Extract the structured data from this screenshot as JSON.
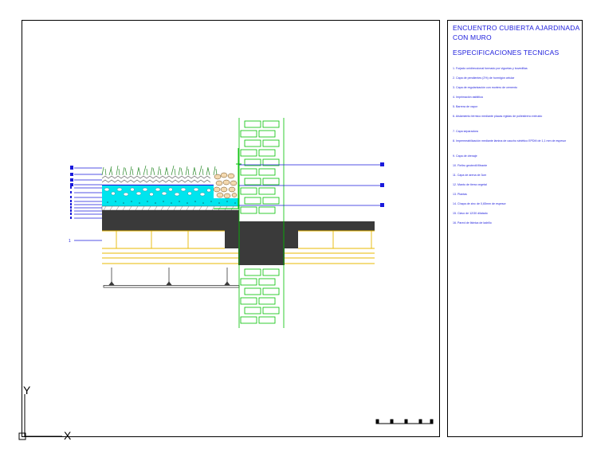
{
  "title_block": {
    "title_line1": "ENCUENTRO CUBIERTA AJARDINADA",
    "title_line2": "CON  MURO",
    "subtitle": "ESPECIFICACIONES TECNICAS",
    "specs": [
      "1. Forjado unidireccional formado por viguetas y bovedillas",
      "2. Capa de pendientes (2%) de hormigón celular",
      "3. Capa de regularización con mortero de cemento",
      "4. Imprimación asfáltica",
      "5. Barrera de vapor",
      "6. Aislamiento térmico mediante placas rígidas de poliestireno extruido",
      "7. Capa separadora",
      "8. Impermeabilización mediante lámina de caucho sintético EPDM de 1,1 mm de espesor",
      "9. Capa de drenaje",
      "10. Fieltro geotextil filtrante",
      "11. Capa de arena de 3cm",
      "12. Manto de tierra vegetal",
      "13. Plantas",
      "14. Chapa de zinc de 0,65mm de espesor",
      "15. Clavo de 12/30 dilatado",
      "16. Pared de fábrica de ladrillo"
    ]
  },
  "callouts_left": [
    "1"
  ],
  "ucs": {
    "x_label": "X",
    "y_label": "Y"
  },
  "colors": {
    "blue": "#1a1adc",
    "green": "#00c000",
    "cyan": "#00e5ee",
    "concrete": "#3a3a3a",
    "timber": "#e8b800"
  }
}
